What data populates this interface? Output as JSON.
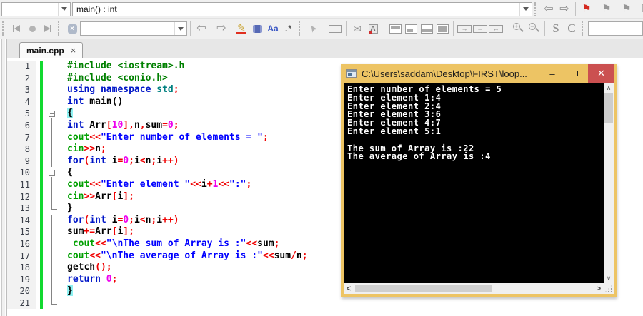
{
  "toolbar": {
    "target_combo_value": "",
    "symbol_combo_value": "main() : int",
    "search_combo_value": "",
    "match_case_label": "Aa",
    "regex_label": ".*",
    "s_label": "S",
    "c_label": "C",
    "letter_doc_label": "A",
    "zoom_in_sign": "+",
    "zoom_out_sign": "−"
  },
  "icons": {
    "arrow_left": "⇦",
    "arrow_right": "⇨",
    "flag": "⚑",
    "pencil": "✎",
    "cursor": "➤",
    "envelope": "✉",
    "stop_x": "×",
    "box_arrow_right": "→",
    "box_arrow_left": "←",
    "box_arrow_both": "↔",
    "tab_close": "×",
    "minimize": "–",
    "close_x": "✕",
    "scroll_up": "∧",
    "scroll_down": "∨",
    "scroll_left": "<",
    "scroll_right": ">"
  },
  "tabs": [
    {
      "label": "main.cpp"
    }
  ],
  "editor": {
    "lines": [
      {
        "fold": "none",
        "seg": [
          [
            "pre",
            "#include <iostream>.h"
          ]
        ]
      },
      {
        "fold": "none",
        "seg": [
          [
            "pre",
            "#include <conio.h>"
          ]
        ]
      },
      {
        "fold": "none",
        "seg": [
          [
            "kw",
            "using"
          ],
          [
            "pl",
            " "
          ],
          [
            "kw",
            "namespace"
          ],
          [
            "pl",
            " "
          ],
          [
            "std",
            "std"
          ],
          [
            "op",
            ";"
          ]
        ]
      },
      {
        "fold": "none",
        "seg": [
          [
            "kw",
            "int"
          ],
          [
            "pl",
            " main()"
          ]
        ]
      },
      {
        "fold": "box",
        "seg": [
          [
            "brace",
            "{"
          ]
        ]
      },
      {
        "fold": "line",
        "seg": [
          [
            "kw",
            "int"
          ],
          [
            "pl",
            " Arr"
          ],
          [
            "op",
            "["
          ],
          [
            "num",
            "10"
          ],
          [
            "op",
            "],"
          ],
          [
            "pl",
            "n"
          ],
          [
            "op",
            ","
          ],
          [
            "pl",
            "sum"
          ],
          [
            "op",
            "="
          ],
          [
            "num",
            "0"
          ],
          [
            "op",
            ";"
          ]
        ]
      },
      {
        "fold": "line",
        "seg": [
          [
            "io",
            "cout"
          ],
          [
            "op",
            "<<"
          ],
          [
            "str",
            "\"Enter number of elements = \""
          ],
          [
            "op",
            ";"
          ]
        ]
      },
      {
        "fold": "line",
        "seg": [
          [
            "io",
            "cin"
          ],
          [
            "op",
            ">>"
          ],
          [
            "pl",
            "n"
          ],
          [
            "op",
            ";"
          ]
        ]
      },
      {
        "fold": "line",
        "seg": [
          [
            "kw",
            "for"
          ],
          [
            "op",
            "("
          ],
          [
            "kw",
            "int"
          ],
          [
            "pl",
            " i"
          ],
          [
            "op",
            "="
          ],
          [
            "num",
            "0"
          ],
          [
            "op",
            ";"
          ],
          [
            "pl",
            "i"
          ],
          [
            "op",
            "<"
          ],
          [
            "pl",
            "n"
          ],
          [
            "op",
            ";"
          ],
          [
            "pl",
            "i"
          ],
          [
            "op",
            "++)"
          ]
        ]
      },
      {
        "fold": "box",
        "seg": [
          [
            "pl",
            "{"
          ]
        ]
      },
      {
        "fold": "line",
        "seg": [
          [
            "io",
            "cout"
          ],
          [
            "op",
            "<<"
          ],
          [
            "str",
            "\"Enter element \""
          ],
          [
            "op",
            "<<"
          ],
          [
            "pl",
            "i"
          ],
          [
            "op",
            "+"
          ],
          [
            "num",
            "1"
          ],
          [
            "op",
            "<<"
          ],
          [
            "str",
            "\":\""
          ],
          [
            "op",
            ";"
          ]
        ]
      },
      {
        "fold": "line",
        "seg": [
          [
            "io",
            "cin"
          ],
          [
            "op",
            ">>"
          ],
          [
            "pl",
            "Arr"
          ],
          [
            "op",
            "["
          ],
          [
            "pl",
            "i"
          ],
          [
            "op",
            "];"
          ]
        ]
      },
      {
        "fold": "end",
        "seg": [
          [
            "pl",
            "}"
          ]
        ]
      },
      {
        "fold": "line",
        "seg": [
          [
            "kw",
            "for"
          ],
          [
            "op",
            "("
          ],
          [
            "kw",
            "int"
          ],
          [
            "pl",
            " i"
          ],
          [
            "op",
            "="
          ],
          [
            "num",
            "0"
          ],
          [
            "op",
            ";"
          ],
          [
            "pl",
            "i"
          ],
          [
            "op",
            "<"
          ],
          [
            "pl",
            "n"
          ],
          [
            "op",
            ";"
          ],
          [
            "pl",
            "i"
          ],
          [
            "op",
            "++)"
          ]
        ]
      },
      {
        "fold": "line",
        "seg": [
          [
            "pl",
            "sum"
          ],
          [
            "op",
            "+="
          ],
          [
            "pl",
            "Arr"
          ],
          [
            "op",
            "["
          ],
          [
            "pl",
            "i"
          ],
          [
            "op",
            "];"
          ]
        ]
      },
      {
        "fold": "line",
        "seg": [
          [
            "pl",
            " "
          ],
          [
            "io",
            "cout"
          ],
          [
            "op",
            "<<"
          ],
          [
            "str",
            "\"\\nThe sum of Array is :\""
          ],
          [
            "op",
            "<<"
          ],
          [
            "pl",
            "sum"
          ],
          [
            "op",
            ";"
          ]
        ]
      },
      {
        "fold": "line",
        "seg": [
          [
            "io",
            "cout"
          ],
          [
            "op",
            "<<"
          ],
          [
            "str",
            "\"\\nThe average of Array is :\""
          ],
          [
            "op",
            "<<"
          ],
          [
            "pl",
            "sum"
          ],
          [
            "op",
            "/"
          ],
          [
            "pl",
            "n"
          ],
          [
            "op",
            ";"
          ]
        ]
      },
      {
        "fold": "line",
        "seg": [
          [
            "pl",
            "getch"
          ],
          [
            "op",
            "();"
          ]
        ]
      },
      {
        "fold": "line",
        "seg": [
          [
            "kw",
            "return"
          ],
          [
            "pl",
            " "
          ],
          [
            "num",
            "0"
          ],
          [
            "op",
            ";"
          ]
        ]
      },
      {
        "fold": "line",
        "seg": [
          [
            "brace",
            "}"
          ]
        ]
      },
      {
        "fold": "end",
        "seg": []
      }
    ]
  },
  "console": {
    "title": "C:\\Users\\saddam\\Desktop\\FIRST\\loop...",
    "lines": [
      "Enter number of elements = 5",
      "Enter element 1:4",
      "Enter element 2:4",
      "Enter element 3:6",
      "Enter element 4:7",
      "Enter element 5:1",
      "",
      "The sum of Array is :22",
      "The average of Array is :4"
    ]
  },
  "colors": {
    "console_border": "#edc464",
    "close_button": "#cb5050",
    "console_bg": "#000000",
    "console_text": "#ffffff",
    "change_bar": "#12d930",
    "brace_highlight": "#8ff2f2",
    "preprocessor": "#008000",
    "keyword": "#0016c8",
    "stream_keyword": "#00a000",
    "string": "#0000ff",
    "number": "#ee00ee",
    "operator": "#f00000"
  }
}
